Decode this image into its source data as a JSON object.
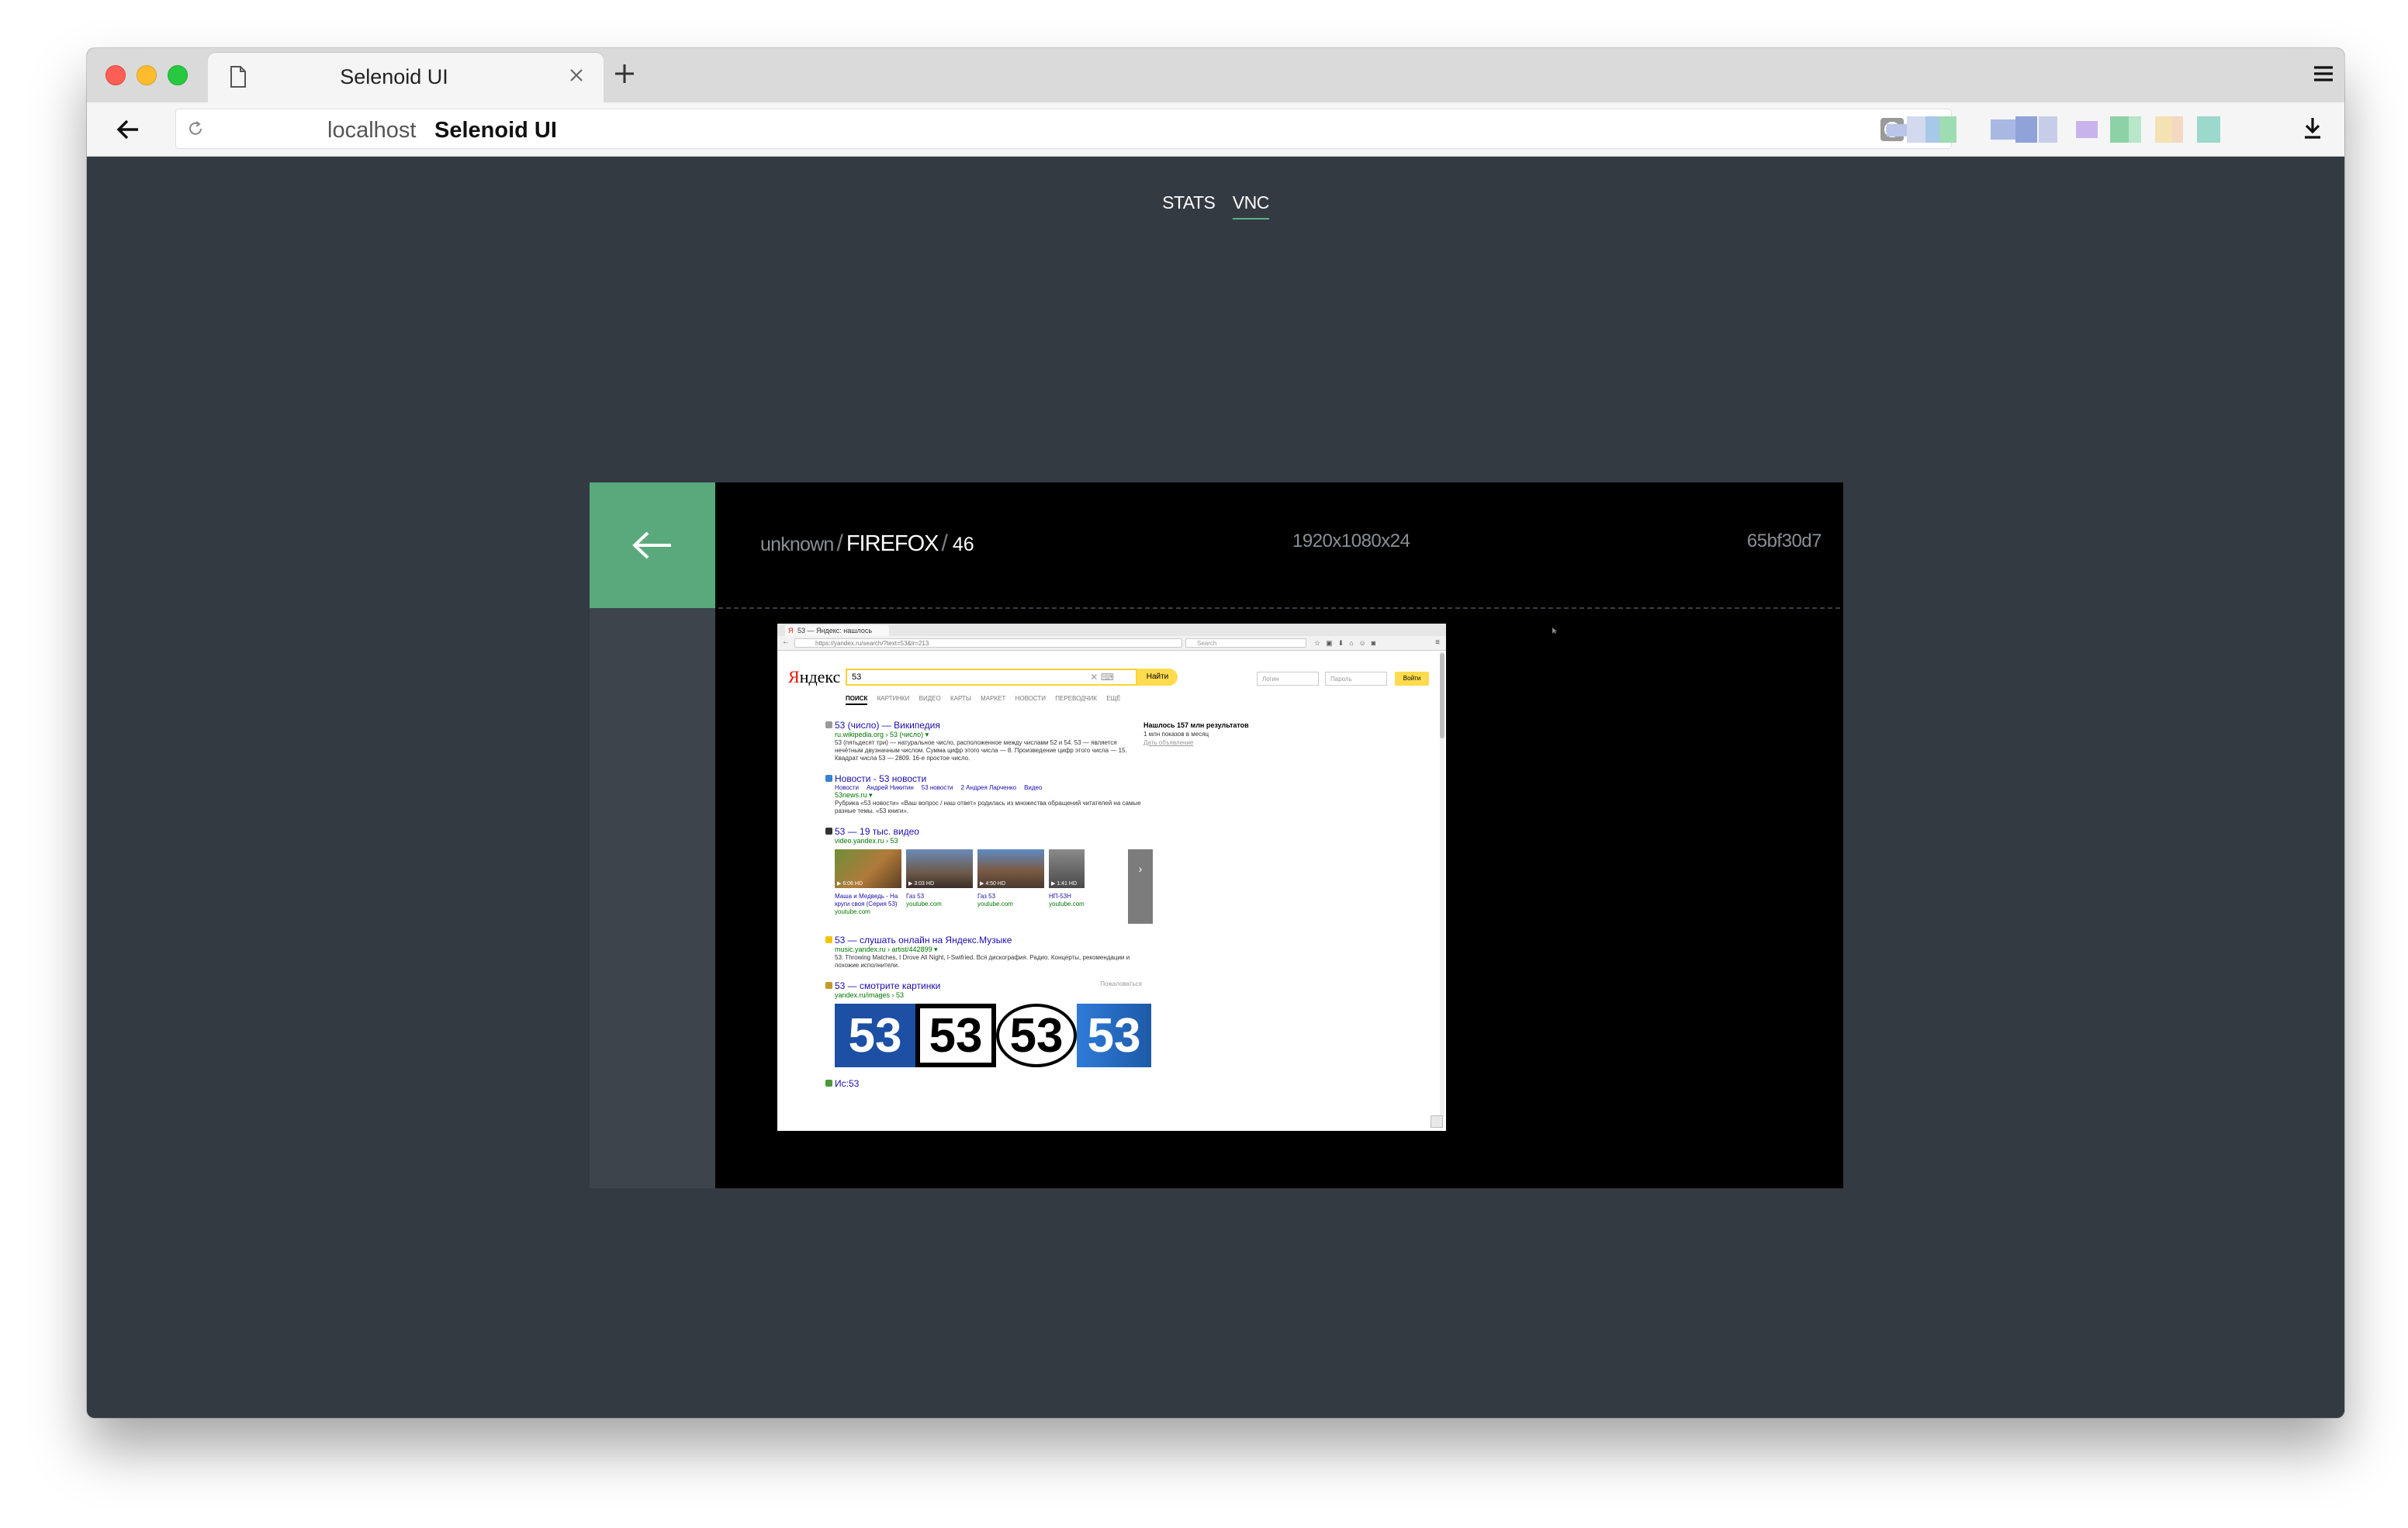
{
  "browser": {
    "tab_title": "Selenoid UI",
    "url_host": "localhost",
    "url_title": "Selenoid UI",
    "icons": [
      "page-icon",
      "close-icon",
      "plus-icon",
      "hamburger-menu-icon",
      "back-arrow-icon",
      "reload-icon",
      "translate-icon",
      "star-icon",
      "download-icon"
    ]
  },
  "nav": {
    "links": [
      {
        "label": "STATS",
        "active": false
      },
      {
        "label": "VNC",
        "active": true
      }
    ]
  },
  "session": {
    "name": "unknown",
    "browser": "FIREFOX",
    "version": "46",
    "resolution": "1920x1080x24",
    "id": "65bf30d7"
  },
  "colors": {
    "background": "#343a42",
    "accent_green": "#5aa97c",
    "panel_black": "#000000",
    "sidebar_gray": "#3e444c"
  },
  "vnc_screen": {
    "tab_text": "53 — Яндекс: нашлось",
    "url": "https://yandex.ru/search/?text=53&lr=213",
    "search_placeholder": "Search",
    "logo_ya": "Я",
    "logo_rest": "ндекс",
    "query": "53",
    "find_button": "Найти",
    "login_placeholder": "Логин",
    "password_placeholder": "Пароль",
    "enter_button": "Войти",
    "tabs": [
      "ПОИСК",
      "КАРТИНКИ",
      "ВИДЕО",
      "КАРТЫ",
      "МАРКЕТ",
      "НОВОСТИ",
      "ПЕРЕВОДЧИК",
      "ЕЩЁ"
    ],
    "result1": {
      "title": "53 (число) — Википедия",
      "url": "ru.wikipedia.org › 53 (число) ▾",
      "text": "53 (пятьдесят три) — натуральное число, расположенное между числами 52 и 54. 53 — является нечётным двузначным числом. Сумма цифр этого числа — 8. Произведение цифр этого числа — 15. Квадрат числа 53 — 2809. 16-е простое число."
    },
    "result2": {
      "title": "Новости - 53 новости",
      "links": [
        "Новости",
        "Андрей Никитин",
        "53 новости",
        "2 Андрея Ларченко",
        "Видео"
      ],
      "url": "53news.ru ▾",
      "text": "Рубрика «53 новости» «Ваш вопрос / наш ответ» родилась из множества обращений читателей на самые разные темы. «53 книги»."
    },
    "result3": {
      "title": "53 — 19 тыс. видео",
      "url": "video.yandex.ru › 53",
      "videos": [
        {
          "duration": "▶ 6:06 HD",
          "caption": "Маша и Медведь - На круги своя (Серия 53)",
          "source": "youtube.com"
        },
        {
          "duration": "▶ 3:03 HD",
          "caption": "Газ 53",
          "source": "youtube.com"
        },
        {
          "duration": "▶ 4:50 HD",
          "caption": "Газ 53",
          "source": "youtube.com"
        },
        {
          "duration": "▶ 1:41 HD",
          "caption": "НП-53Н",
          "source": "youtube.com"
        }
      ]
    },
    "result4": {
      "title": "53 — слушать онлайн на Яндекс.Музыке",
      "url": "music.yandex.ru › artist/442899 ▾",
      "text": "53: Throwing Matches, I Drove All Night, I-Swifried. Вся дискография. Радио. Концерты, рекомендации и похожие исполнители."
    },
    "result5": {
      "title": "53 — смотрите картинки",
      "url": "yandex.ru/images › 53",
      "more": "Пожаловаться",
      "tiles": [
        "53",
        "53",
        "53",
        "53"
      ]
    },
    "result6": {
      "title": "Ис:53"
    },
    "side": {
      "line1": "Нашлось 157 млн результатов",
      "line2": "1 млн показов в месяц",
      "line3": "Дать объявление"
    }
  }
}
